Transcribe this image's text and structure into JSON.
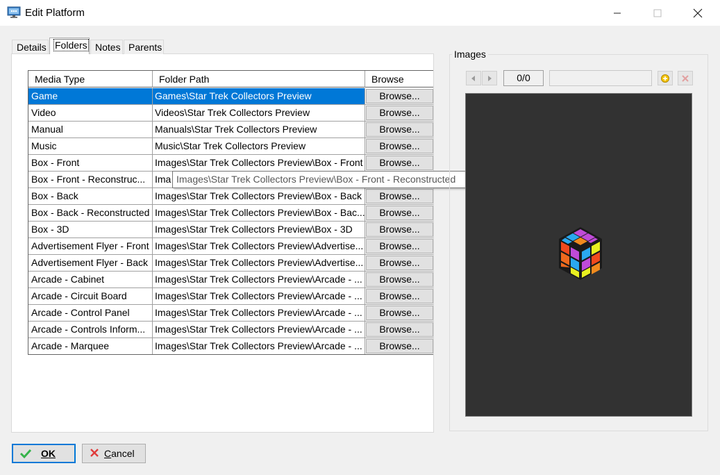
{
  "window": {
    "title": "Edit Platform"
  },
  "tabs": [
    {
      "label": "Details"
    },
    {
      "label": "Folders"
    },
    {
      "label": "Notes"
    },
    {
      "label": "Parents"
    }
  ],
  "grid": {
    "columns": [
      "Media Type",
      "Folder Path",
      "Browse"
    ],
    "browse_label": "Browse...",
    "rows": [
      {
        "media": "Game",
        "path": "Games\\Star Trek Collectors Preview"
      },
      {
        "media": "Video",
        "path": "Videos\\Star Trek Collectors Preview"
      },
      {
        "media": "Manual",
        "path": "Manuals\\Star Trek Collectors Preview"
      },
      {
        "media": "Music",
        "path": "Music\\Star Trek Collectors Preview"
      },
      {
        "media": "Box - Front",
        "path": "Images\\Star Trek Collectors Preview\\Box - Front"
      },
      {
        "media": "Box - Front - Reconstruc...",
        "path": "Ima"
      },
      {
        "media": "Box - Back",
        "path": "Images\\Star Trek Collectors Preview\\Box - Back"
      },
      {
        "media": "Box - Back - Reconstructed",
        "path": "Images\\Star Trek Collectors Preview\\Box - Bac..."
      },
      {
        "media": "Box - 3D",
        "path": "Images\\Star Trek Collectors Preview\\Box - 3D"
      },
      {
        "media": "Advertisement Flyer - Front",
        "path": "Images\\Star Trek Collectors Preview\\Advertise..."
      },
      {
        "media": "Advertisement Flyer - Back",
        "path": "Images\\Star Trek Collectors Preview\\Advertise..."
      },
      {
        "media": "Arcade - Cabinet",
        "path": "Images\\Star Trek Collectors Preview\\Arcade - ..."
      },
      {
        "media": "Arcade - Circuit Board",
        "path": "Images\\Star Trek Collectors Preview\\Arcade - ..."
      },
      {
        "media": "Arcade - Control Panel",
        "path": "Images\\Star Trek Collectors Preview\\Arcade - ..."
      },
      {
        "media": "Arcade - Controls Inform...",
        "path": "Images\\Star Trek Collectors Preview\\Arcade - ..."
      },
      {
        "media": "Arcade - Marquee",
        "path": "Images\\Star Trek Collectors Preview\\Arcade - ..."
      }
    ],
    "selected_row": 0
  },
  "tooltip": {
    "text": "Images\\Star Trek Collectors Preview\\Box - Front - Reconstructed"
  },
  "images": {
    "label": "Images",
    "counter": "0/0"
  },
  "buttons": {
    "ok_first": "O",
    "ok_rest": "K",
    "cancel_first": "C",
    "cancel_rest": "ancel"
  },
  "colors": {
    "selection": "#0078d7",
    "preview_bg": "#323232"
  }
}
